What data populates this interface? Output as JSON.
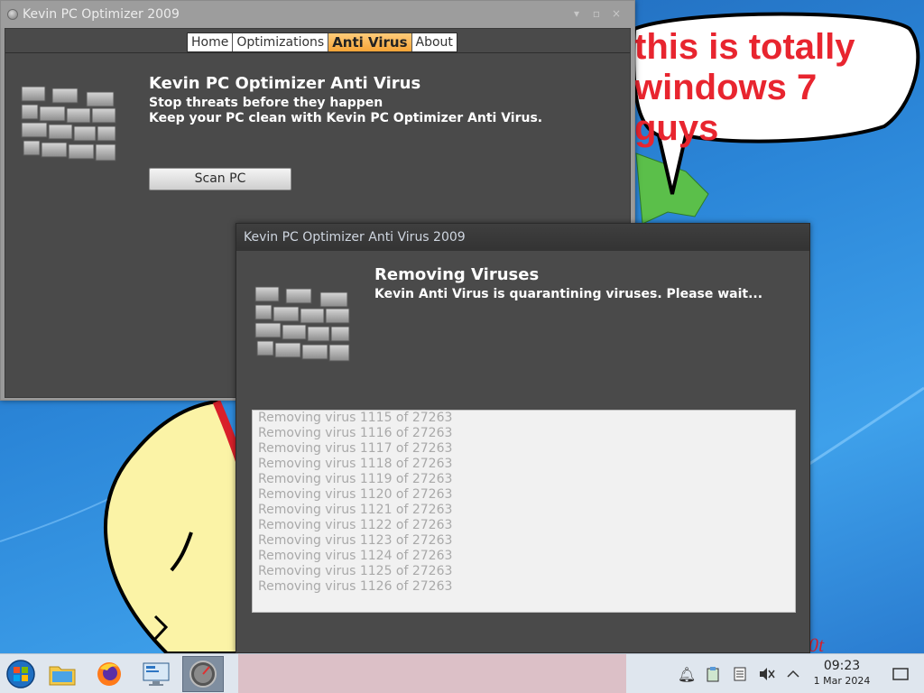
{
  "desktop": {
    "speech_bubble_lines": [
      "this is totally",
      "windows 7 guys"
    ]
  },
  "main_window": {
    "title": "Kevin PC Optimizer 2009",
    "tabs": [
      {
        "label": "Home",
        "active": false
      },
      {
        "label": "Optimizations",
        "active": false
      },
      {
        "label": "Anti Virus",
        "active": true
      },
      {
        "label": "About",
        "active": false
      }
    ],
    "heading": "Kevin PC Optimizer Anti Virus",
    "sub1": "Stop threats before they happen",
    "sub2": "Keep your PC clean with Kevin PC Optimizer Anti Virus.",
    "scan_button": "Scan PC"
  },
  "av_window": {
    "title": "Kevin PC Optimizer Anti Virus 2009",
    "heading": "Removing Viruses",
    "message": "Kevin Anti Virus is quarantining viruses. Please wait...",
    "log": [
      "Removing virus 1115 of 27263",
      "Removing virus 1116 of 27263",
      "Removing virus 1117 of 27263",
      "Removing virus 1118 of 27263",
      "Removing virus 1119 of 27263",
      "Removing virus 1120 of 27263",
      "Removing virus 1121 of 27263",
      "Removing virus 1122 of 27263",
      "Removing virus 1123 of 27263",
      "Removing virus 1124 of 27263",
      "Removing virus 1125 of 27263",
      "Removing virus 1126 of 27263"
    ]
  },
  "taskbar": {
    "apps": [
      {
        "name": "start-menu",
        "icon": "windows-orb-icon"
      },
      {
        "name": "file-manager",
        "icon": "folder-icon"
      },
      {
        "name": "firefox",
        "icon": "firefox-icon"
      },
      {
        "name": "control-panel",
        "icon": "monitor-icon"
      },
      {
        "name": "optimizer",
        "icon": "gauge-icon",
        "active": true
      }
    ],
    "tray": [
      "bell-icon",
      "clipboard-icon",
      "notes-icon",
      "volume-muted-icon",
      "chevron-up-icon"
    ],
    "clock_time": "09:23",
    "clock_date": "1 Mar 2024"
  },
  "colors": {
    "active_tab": "#f6a437",
    "window_bg": "#4a4a4a",
    "speech_text": "#e8252f"
  }
}
